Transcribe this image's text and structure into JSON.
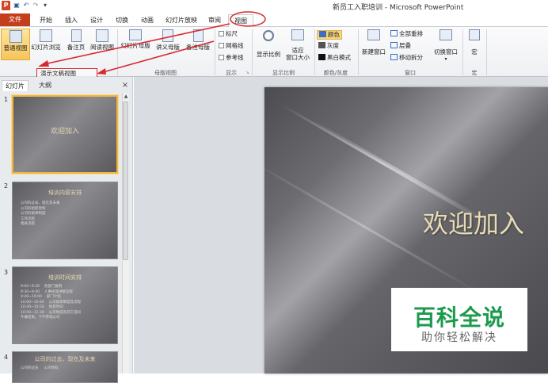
{
  "window": {
    "app_icon": "P",
    "title": "新员工入职培训 - Microsoft PowerPoint"
  },
  "qat": {
    "save": "save-icon",
    "undo": "undo-icon",
    "redo": "redo-icon",
    "customize": "▾"
  },
  "tabs": [
    "文件",
    "开始",
    "插入",
    "设计",
    "切换",
    "动画",
    "幻灯片放映",
    "审阅",
    "视图"
  ],
  "ribbon": {
    "presentation_views": {
      "buttons": [
        "普通视图",
        "幻灯片浏览",
        "备注页",
        "阅读视图"
      ],
      "label": "演示文稿视图"
    },
    "master_views": {
      "buttons": [
        "幻灯片母版",
        "讲义母版",
        "备注母版"
      ],
      "label": "母版视图"
    },
    "show": {
      "items": [
        "标尺",
        "网格线",
        "参考线"
      ],
      "label": "显示"
    },
    "zoom": {
      "buttons": [
        "显示比例",
        "适应\n窗口大小"
      ],
      "zoom_label": "显示比例",
      "fit_line1": "适应",
      "fit_line2": "窗口大小",
      "label": "显示比例"
    },
    "color": {
      "items": [
        "颜色",
        "灰度",
        "黑白模式"
      ],
      "label": "颜色/灰度"
    },
    "window": {
      "new_window": "新建窗口",
      "items": [
        "全部重排",
        "层叠",
        "移动拆分"
      ],
      "switch": "切换窗口",
      "label": "窗口"
    },
    "macros": {
      "button": "宏",
      "label": "宏"
    }
  },
  "panel": {
    "tabs": [
      "幻灯片",
      "大纲"
    ],
    "close": "×",
    "slides": [
      {
        "num": "1",
        "title": "欢迎加入",
        "bullets": []
      },
      {
        "num": "2",
        "title": "培训内容安排",
        "bullets": [
          "公司的过去、现在及未来",
          "公司的组织架构",
          "公司的规章制度",
          "工作流程",
          "相关流程"
        ]
      },
      {
        "num": "3",
        "title": "培训时间安排",
        "bullets": [
          "9:00~9:30  　各部门报到",
          "9:30~9:40  　人事经理讲解议程",
          "9:40~10:00 　部门介绍",
          "10:00~10:40 　公司规章制度及流程",
          "10:40~10:50 　休息时间",
          "10:50~11:30 　公司制度及其它培训",
          "午餐结束，下午参观公司"
        ]
      },
      {
        "num": "4",
        "title": "公司的过去、现在及未来",
        "bullets": [
          "公司的过去",
          "公司目标"
        ]
      }
    ]
  },
  "slide": {
    "title": "欢迎加入"
  },
  "watermark": {
    "title": "百科全说",
    "subtitle": "助你轻松解决"
  },
  "colors": {
    "file_tab": "#c43e1c",
    "annotation": "#d9272e",
    "slide_title": "#e8dcb4",
    "watermark": "#1d9a4d"
  }
}
